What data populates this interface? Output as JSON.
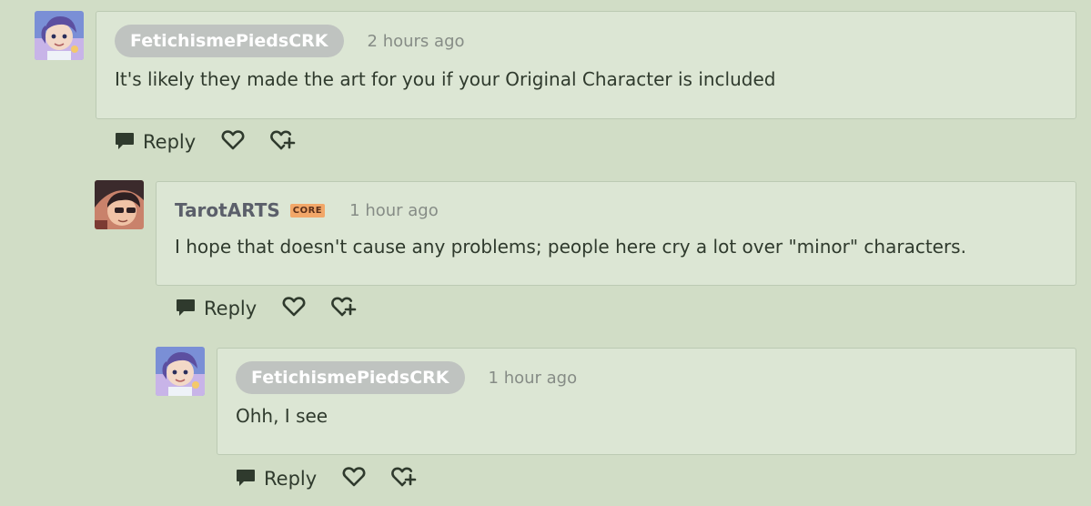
{
  "comments": [
    {
      "username": "FetichismePiedsCRK",
      "timestamp": "2 hours ago",
      "text": "It's likely they made the art for you if your Original Character is included",
      "reply_label": "Reply",
      "avatar_icon": "anime-character-avatar"
    },
    {
      "username": "TarotARTS",
      "badge": "CORE",
      "timestamp": "1 hour ago",
      "text": "I hope that doesn't cause any problems; people here cry a lot over \"minor\" characters.",
      "reply_label": "Reply",
      "avatar_icon": "anime-character-avatar"
    },
    {
      "username": "FetichismePiedsCRK",
      "timestamp": "1 hour ago",
      "text": "Ohh, I see",
      "reply_label": "Reply",
      "avatar_icon": "anime-character-avatar"
    }
  ],
  "colors": {
    "background": "#d1ddc6",
    "card": "#dce6d4",
    "username_pill": "#bfc3c0",
    "core_badge": "#f2a769",
    "icon": "#2f3a2d"
  }
}
